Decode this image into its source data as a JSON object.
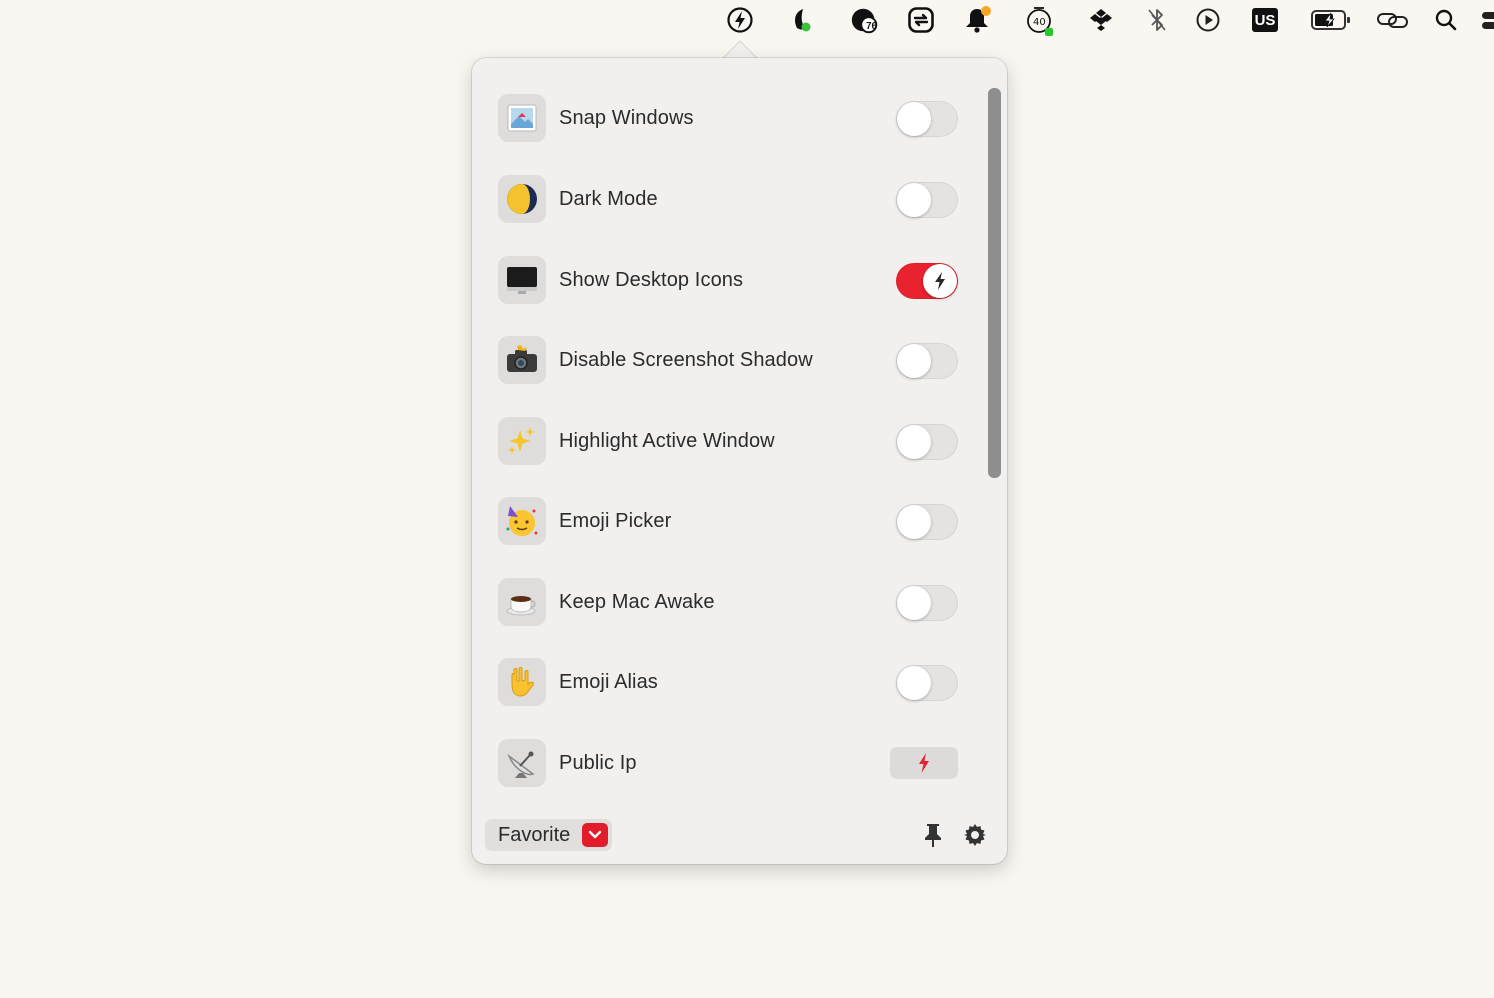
{
  "menubar": {
    "icons": [
      "lightning-bolt-icon",
      "leaf-icon",
      "badge-icon",
      "sync-icon",
      "notification-bell-icon",
      "activity-monitor-icon",
      "dropbox-icon",
      "bluetooth-icon",
      "play-icon",
      "keyboard-input-icon",
      "battery-icon",
      "link-icon",
      "search-icon",
      "control-center-icon"
    ],
    "badge_count": "76",
    "input_source": "US",
    "status_dot_colors": {
      "green": "#3ac23a",
      "orange": "#f5a623"
    }
  },
  "panel": {
    "items": [
      {
        "label": "Snap Windows",
        "icon": "snap-windows-icon",
        "control": "toggle",
        "on": false
      },
      {
        "label": "Dark Mode",
        "icon": "half-moon-icon",
        "control": "toggle",
        "on": false
      },
      {
        "label": "Show Desktop Icons",
        "icon": "desktop-monitor-icon",
        "control": "toggle",
        "on": true
      },
      {
        "label": "Disable Screenshot Shadow",
        "icon": "camera-flash-icon",
        "control": "toggle",
        "on": false
      },
      {
        "label": "Highlight Active Window",
        "icon": "sparkles-icon",
        "control": "toggle",
        "on": false
      },
      {
        "label": "Emoji Picker",
        "icon": "party-face-icon",
        "control": "toggle",
        "on": false
      },
      {
        "label": "Keep Mac Awake",
        "icon": "coffee-cup-icon",
        "control": "toggle",
        "on": false
      },
      {
        "label": "Emoji Alias",
        "icon": "love-you-hand-icon",
        "control": "toggle",
        "on": false
      },
      {
        "label": "Public Ip",
        "icon": "satellite-dish-icon",
        "control": "action",
        "on": false
      }
    ],
    "footer": {
      "category_label": "Favorite",
      "pin_icon": "pin-icon",
      "settings_icon": "gear-icon"
    },
    "accent_color": "#e8222e"
  }
}
